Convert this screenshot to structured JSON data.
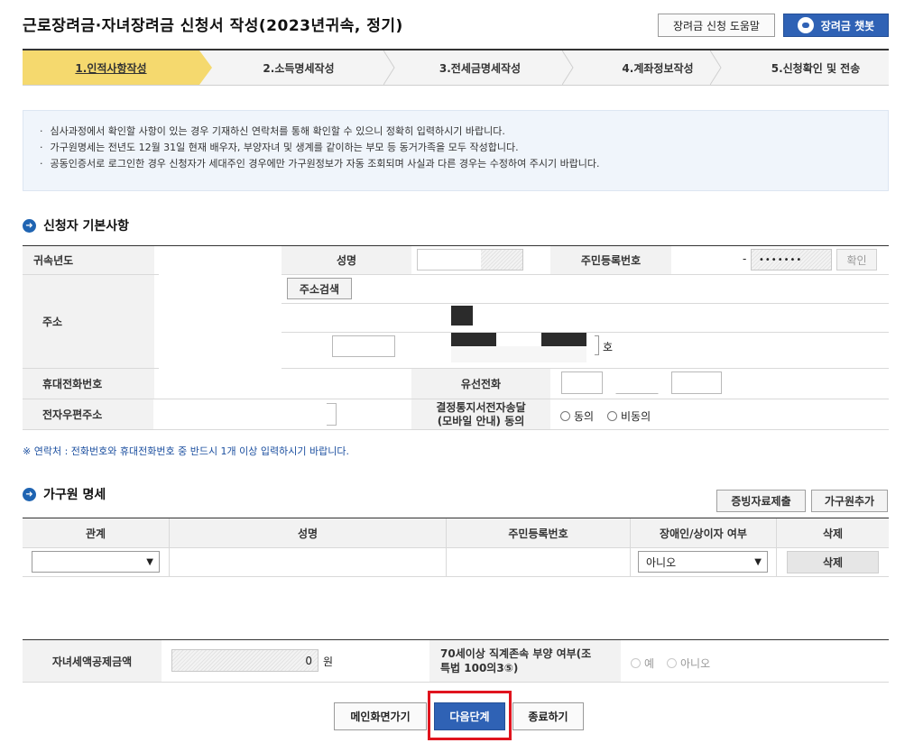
{
  "header": {
    "title": "근로장려금·자녀장려금 신청서 작성(2023년귀속, 정기)",
    "help_label": "장려금 신청 도움말",
    "chatbot_label": "장려금 챗봇"
  },
  "steps": [
    {
      "label": "1.인적사항작성",
      "active": true
    },
    {
      "label": "2.소득명세작성",
      "active": false
    },
    {
      "label": "3.전세금명세작성",
      "active": false
    },
    {
      "label": "4.계좌정보작성",
      "active": false
    },
    {
      "label": "5.신청확인 및 전송",
      "active": false
    }
  ],
  "notices": [
    "심사과정에서 확인할 사항이 있는 경우 기재하신 연락처를 통해 확인할 수 있으니 정확히 입력하시기 바랍니다.",
    "가구원명세는 전년도 12월 31일 현재 배우자, 부양자녀 및 생계를 같이하는 부모 등 동거가족을 모두 작성합니다.",
    "공동인증서로 로그인한 경우 신청자가 세대주인 경우에만 가구원정보가 자동 조회되며 사실과 다른 경우는 수정하여 주시기 바랍니다."
  ],
  "applicant": {
    "section_title": "신청자 기본사항",
    "year_label": "귀속년도",
    "name_label": "성명",
    "rrn_label": "주민등록번호",
    "rrn_dash": "-",
    "rrn_back_value": "•••••••",
    "confirm_label": "확인",
    "address_label": "주소",
    "address_search_label": "주소검색",
    "ho_label": "호",
    "mobile_label": "휴대전화번호",
    "landline_label": "유선전화",
    "email_label": "전자우편주소",
    "notice_consent_label_1": "결정통지서전자송달",
    "notice_consent_label_2": "(모바일 안내) 동의",
    "agree_label": "동의",
    "disagree_label": "비동의"
  },
  "contact_note": "※ 연락처 : 전화번호와 휴대전화번호 중 반드시 1개 이상 입력하시기 바랍니다.",
  "household": {
    "section_title": "가구원 명세",
    "evidence_button": "증빙자료제출",
    "add_button": "가구원추가",
    "columns": [
      "관계",
      "성명",
      "주민등록번호",
      "장애인/상이자 여부",
      "삭제"
    ],
    "rows": [
      {
        "relation": "",
        "name": "",
        "rrn": "",
        "disabled": "아니오",
        "delete_label": "삭제"
      }
    ]
  },
  "bottom": {
    "child_credit_label": "자녀세액공제금액",
    "child_credit_value": "0",
    "child_credit_unit": "원",
    "elder_label_1": "70세이상 직계존속 부양 여부(조",
    "elder_label_2": "특법 100의3⑤)",
    "yes_label": "예",
    "no_label": "아니오"
  },
  "actions": {
    "main_label": "메인화면가기",
    "next_label": "다음단계",
    "exit_label": "종료하기"
  },
  "colors": {
    "active_step": "#f5d96e",
    "primary_button": "#2f62b5",
    "highlight_border": "#e0141e"
  }
}
